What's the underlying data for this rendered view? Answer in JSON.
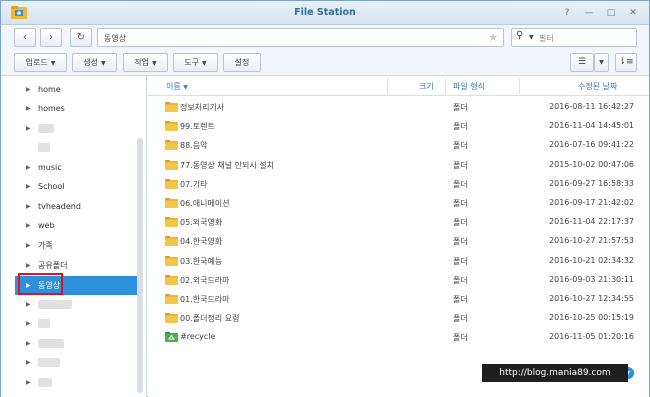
{
  "window": {
    "title": "File Station",
    "buttons": {
      "help": "?",
      "minimize": "—",
      "maximize": "□",
      "close": "✕"
    }
  },
  "nav": {
    "back_icon": "‹",
    "forward_icon": "›",
    "refresh_icon": "↻",
    "path": "동영상",
    "filter_placeholder": "필터"
  },
  "toolbar": {
    "upload": "업로드",
    "create": "생성",
    "action": "작업",
    "tools": "도구",
    "settings": "설정"
  },
  "sidebar": {
    "items": [
      {
        "label": "home"
      },
      {
        "label": "homes"
      },
      {
        "label": ""
      },
      {
        "label": ""
      },
      {
        "label": "music"
      },
      {
        "label": "School"
      },
      {
        "label": "tvheadend"
      },
      {
        "label": "web"
      },
      {
        "label": "가족"
      },
      {
        "label": "공유폴더"
      },
      {
        "label": "동영상"
      },
      {
        "label": ""
      },
      {
        "label": ""
      },
      {
        "label": ""
      },
      {
        "label": ""
      },
      {
        "label": ""
      }
    ],
    "selected_index": 10
  },
  "filelist": {
    "columns": {
      "name": "이름",
      "size": "크기",
      "type": "파일 형식",
      "modified": "수정된 날짜"
    },
    "rows": [
      {
        "name": "정보처리기사",
        "type": "폴더",
        "modified": "2016-08-11 16:42:27",
        "icon": "folder-icon"
      },
      {
        "name": "99.토렌트",
        "type": "폴더",
        "modified": "2016-11-04 14:45:01",
        "icon": "folder-icon"
      },
      {
        "name": "88.음악",
        "type": "폴더",
        "modified": "2016-07-16 09:41:22",
        "icon": "folder-icon"
      },
      {
        "name": "77.동영상 채널 안되시 설치",
        "type": "폴더",
        "modified": "2015-10-02 00:47:06",
        "icon": "folder-icon"
      },
      {
        "name": "07.기타",
        "type": "폴더",
        "modified": "2016-09-27 16:58:33",
        "icon": "folder-icon"
      },
      {
        "name": "06.애니메이션",
        "type": "폴더",
        "modified": "2016-09-17 21:42:02",
        "icon": "folder-icon"
      },
      {
        "name": "05.외국영화",
        "type": "폴더",
        "modified": "2016-11-04 22:17:37",
        "icon": "folder-icon"
      },
      {
        "name": "04.한국영화",
        "type": "폴더",
        "modified": "2016-10-27 21:57:53",
        "icon": "folder-icon"
      },
      {
        "name": "03.한국예능",
        "type": "폴더",
        "modified": "2016-10-21 02:34:32",
        "icon": "folder-icon"
      },
      {
        "name": "02.외국드라마",
        "type": "폴더",
        "modified": "2016-09-03 21:30:11",
        "icon": "folder-icon"
      },
      {
        "name": "01.한국드라마",
        "type": "폴더",
        "modified": "2016-10-27 12:34:55",
        "icon": "folder-icon"
      },
      {
        "name": "00.폴더정리 요령",
        "type": "폴더",
        "modified": "2016-10-25 00:15:19",
        "icon": "folder-icon"
      },
      {
        "name": "#recycle",
        "type": "폴더",
        "modified": "2016-11-05 01:20:16",
        "icon": "recycle-folder-icon"
      }
    ]
  },
  "watermark": "http://blog.mania89.com",
  "colors": {
    "accent": "#2e8fdb",
    "title": "#2e6ea0",
    "folder": "#f0b732",
    "highlight": "#e0141e"
  }
}
